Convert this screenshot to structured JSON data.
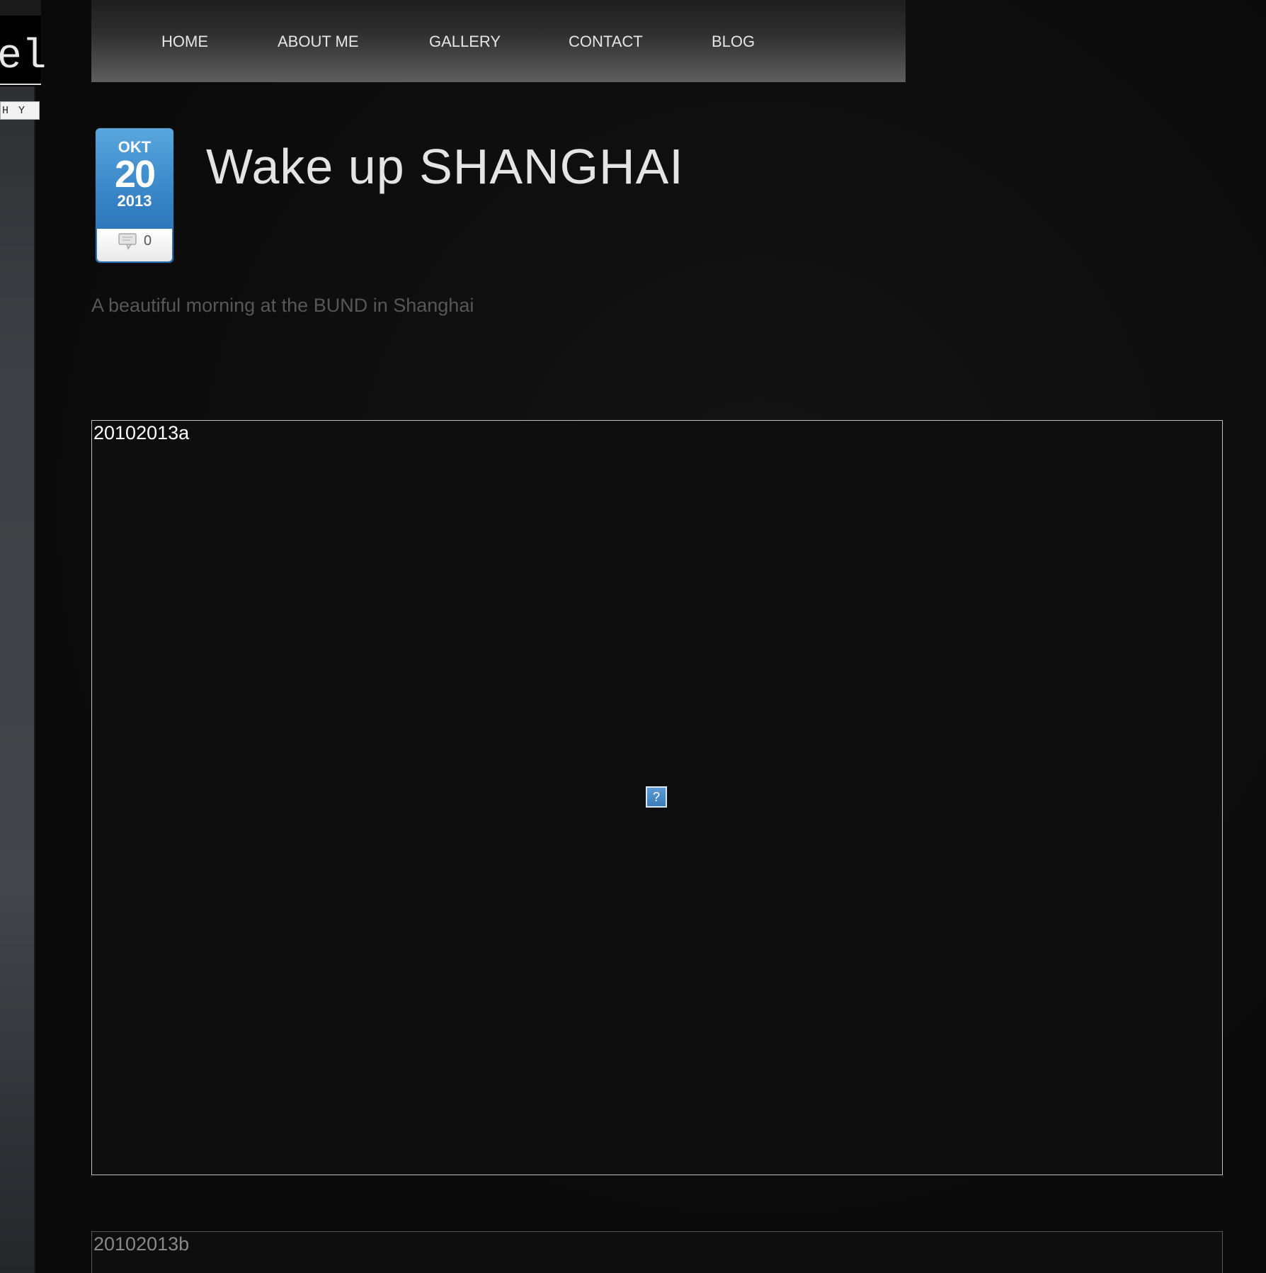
{
  "sidebar": {
    "logo_glyph": "el",
    "logo_sub": "HY"
  },
  "nav": {
    "items": [
      {
        "label": "HOME"
      },
      {
        "label": "ABOUT ME"
      },
      {
        "label": "GALLERY"
      },
      {
        "label": "CONTACT"
      },
      {
        "label": "BLOG"
      }
    ]
  },
  "post": {
    "date": {
      "month": "OKT",
      "day": "20",
      "year": "2013"
    },
    "comment_count": "0",
    "title": "Wake up SHANGHAI",
    "excerpt": "A beautiful morning at the BUND in Shanghai",
    "images": [
      {
        "alt": "20102013a",
        "broken_icon": "?"
      },
      {
        "alt": "20102013b"
      }
    ]
  },
  "colors": {
    "badge_blue": "#3581c4",
    "background": "#0c0c0c",
    "nav_text": "#e6e6e6"
  }
}
